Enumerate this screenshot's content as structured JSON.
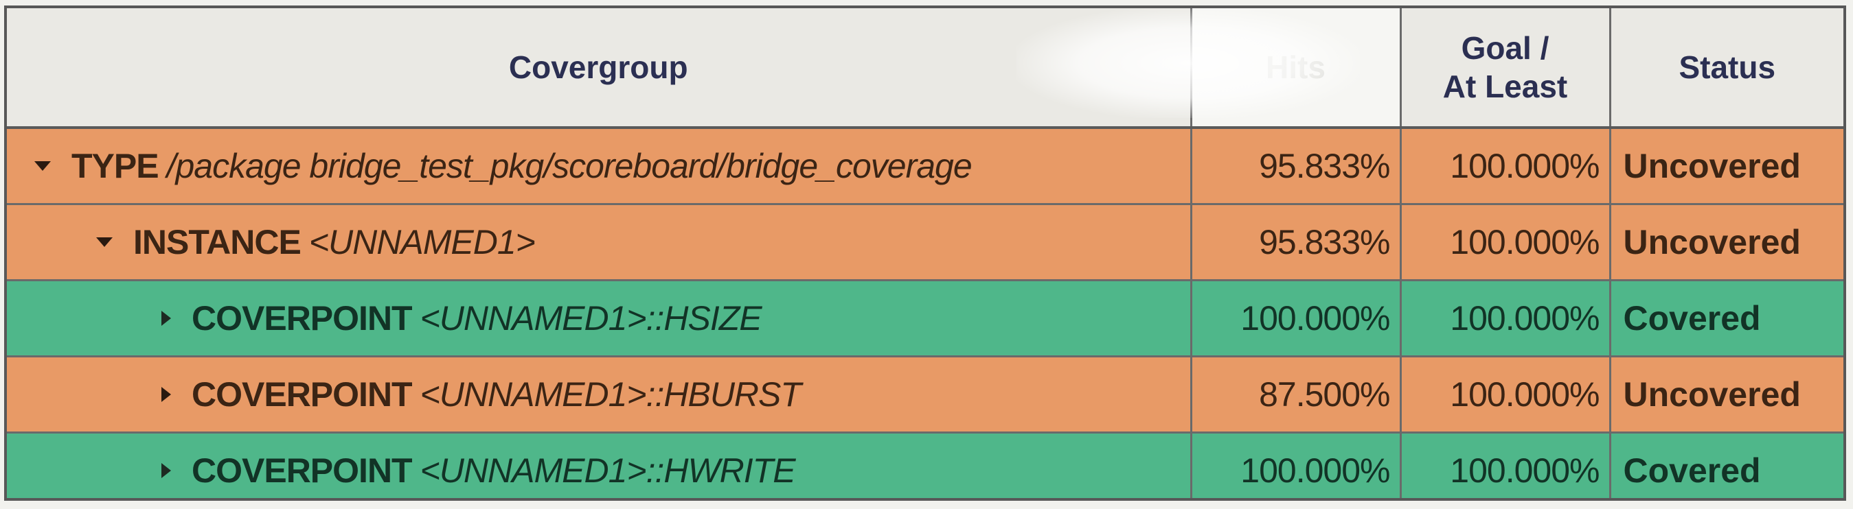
{
  "columns": {
    "covergroup": "Covergroup",
    "hits": "Hits",
    "goal_line1": "Goal /",
    "goal_line2": "At Least",
    "status": "Status"
  },
  "rows": [
    {
      "expand": "expanded",
      "kind": "TYPE",
      "path": "/package bridge_test_pkg/scoreboard/bridge_coverage",
      "hits": "95.833%",
      "goal": "100.000%",
      "status": "Uncovered"
    },
    {
      "expand": "expanded",
      "kind": "INSTANCE",
      "path": "<UNNAMED1>",
      "hits": "95.833%",
      "goal": "100.000%",
      "status": "Uncovered"
    },
    {
      "expand": "collapsed",
      "kind": "COVERPOINT",
      "path": "<UNNAMED1>::HSIZE",
      "hits": "100.000%",
      "goal": "100.000%",
      "status": "Covered"
    },
    {
      "expand": "collapsed",
      "kind": "COVERPOINT",
      "path": "<UNNAMED1>::HBURST",
      "hits": "87.500%",
      "goal": "100.000%",
      "status": "Uncovered"
    },
    {
      "expand": "collapsed",
      "kind": "COVERPOINT",
      "path": "<UNNAMED1>::HWRITE",
      "hits": "100.000%",
      "goal": "100.000%",
      "status": "Covered"
    }
  ],
  "colors": {
    "uncovered": "#e89a66",
    "covered": "#4fb78a",
    "header_text": "#2b2f52"
  },
  "icons": {
    "expanded": "caret-down-icon",
    "collapsed": "caret-right-icon"
  }
}
